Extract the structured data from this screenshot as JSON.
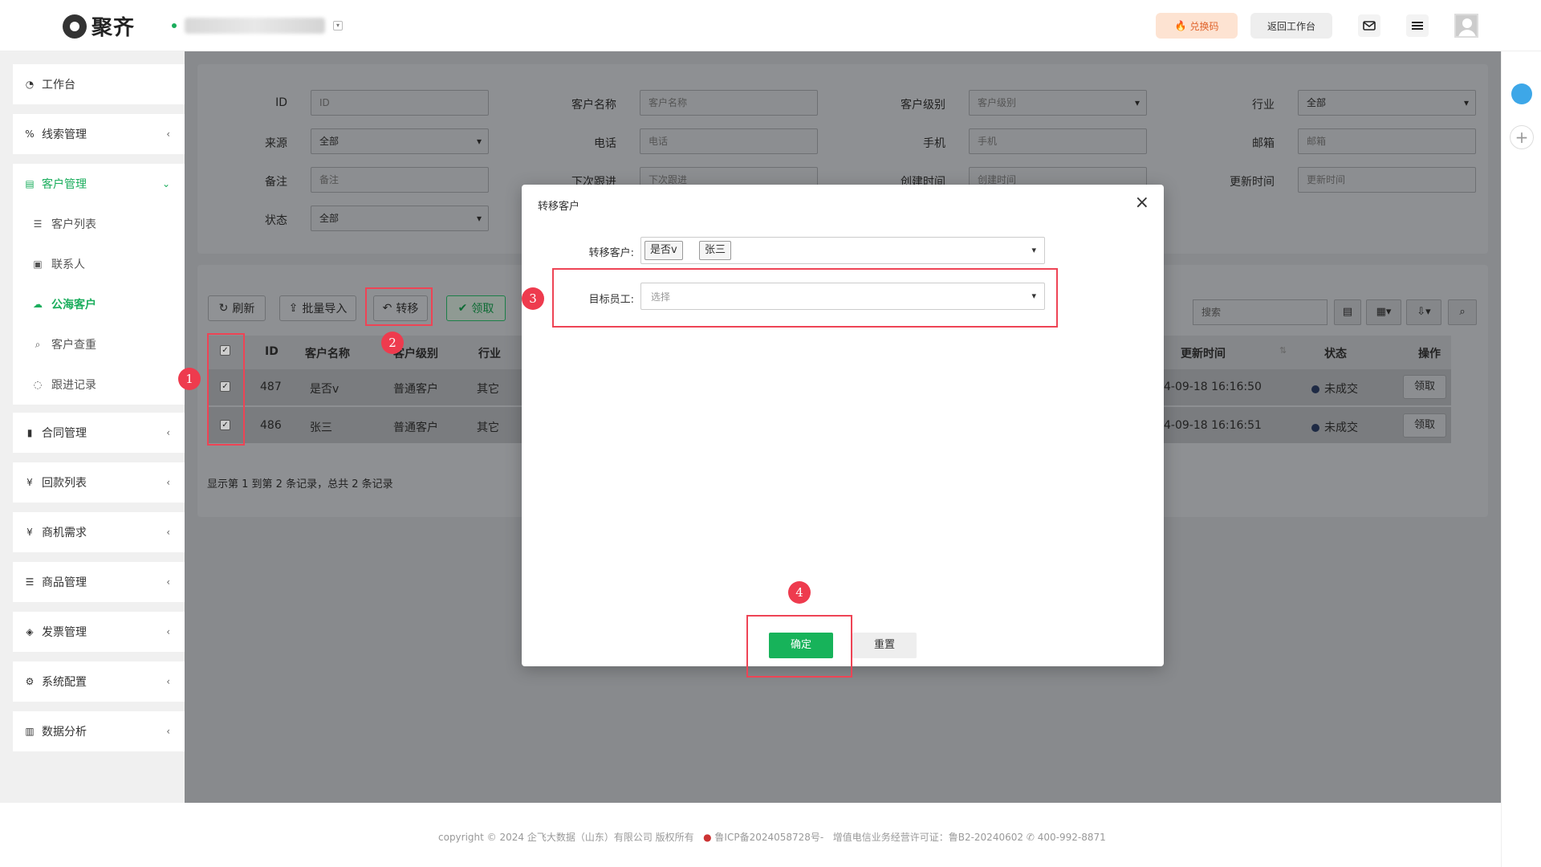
{
  "header": {
    "logo_text": "聚齐",
    "redeem_label": "兑换码",
    "back_label": "返回工作台",
    "icons": [
      "flame-icon",
      "mail-icon",
      "menu-icon",
      "user-avatar"
    ]
  },
  "sidebar": {
    "items": [
      {
        "label": "工作台",
        "icon": "dashboard-icon"
      },
      {
        "label": "线索管理",
        "icon": "link-icon"
      },
      {
        "label": "客户管理",
        "icon": "id-card-icon",
        "active": true
      },
      {
        "label": "合同管理",
        "icon": "bookmark-icon"
      },
      {
        "label": "回款列表",
        "icon": "yen-icon"
      },
      {
        "label": "商机需求",
        "icon": "yen-icon"
      },
      {
        "label": "商品管理",
        "icon": "list-icon"
      },
      {
        "label": "发票管理",
        "icon": "tag-icon"
      },
      {
        "label": "系统配置",
        "icon": "gears-icon"
      },
      {
        "label": "数据分析",
        "icon": "bar-chart-icon"
      }
    ],
    "sub_items": [
      {
        "label": "客户列表",
        "icon": "list-icon"
      },
      {
        "label": "联系人",
        "icon": "contact-icon"
      },
      {
        "label": "公海客户",
        "icon": "cloud-icon",
        "active": true
      },
      {
        "label": "客户查重",
        "icon": "search-icon"
      },
      {
        "label": "跟进记录",
        "icon": "chat-icon"
      }
    ]
  },
  "filters": {
    "id_label": "ID",
    "id_placeholder": "ID",
    "name_label": "客户名称",
    "name_placeholder": "客户名称",
    "level_label": "客户级别",
    "level_placeholder": "客户级别",
    "industry_label": "行业",
    "industry_value": "全部",
    "source_label": "来源",
    "source_value": "全部",
    "phone_label": "电话",
    "phone_placeholder": "电话",
    "mobile_label": "手机",
    "mobile_placeholder": "手机",
    "email_label": "邮箱",
    "email_placeholder": "邮箱",
    "remark_label": "备注",
    "remark_placeholder": "备注",
    "next_label": "下次跟进",
    "next_placeholder": "下次跟进",
    "created_label": "创建时间",
    "created_placeholder": "创建时间",
    "updated_label": "更新时间",
    "updated_placeholder": "更新时间",
    "status_label": "状态",
    "status_value": "全部"
  },
  "toolbar": {
    "refresh": "刷新",
    "import": "批量导入",
    "transfer": "转移",
    "claim": "领取",
    "search_placeholder": "搜索"
  },
  "table": {
    "headers": [
      "ID",
      "客户名称",
      "客户级别",
      "行业",
      "更新时间",
      "状态",
      "操作"
    ],
    "rows": [
      {
        "id": "487",
        "name": "是否v",
        "level": "普通客户",
        "industry": "其它",
        "updated": "4-09-18 16:16:50",
        "status": "未成交",
        "action": "领取"
      },
      {
        "id": "486",
        "name": "张三",
        "level": "普通客户",
        "industry": "其它",
        "updated": "4-09-18 16:16:51",
        "status": "未成交",
        "action": "领取"
      }
    ],
    "pager_text": "显示第 1 到第 2 条记录，总共 2 条记录"
  },
  "modal": {
    "title": "转移客户",
    "customers_label": "转移客户:",
    "customer_tags": [
      "是否v",
      "张三"
    ],
    "target_label": "目标员工:",
    "target_placeholder": "选择",
    "confirm": "确定",
    "reset": "重置"
  },
  "annotations": [
    "1",
    "2",
    "3",
    "4"
  ],
  "footer": {
    "copyright": "copyright © 2024 企飞大数据（山东）有限公司 版权所有",
    "icp": "鲁ICP备2024058728号-",
    "license": "增值电信业务经营许可证：鲁B2-20240602",
    "phone": "400-992-8871"
  },
  "colors": {
    "accent": "#1aad5c",
    "annotation": "#ee3b4e",
    "overlay": "#888a8d"
  }
}
